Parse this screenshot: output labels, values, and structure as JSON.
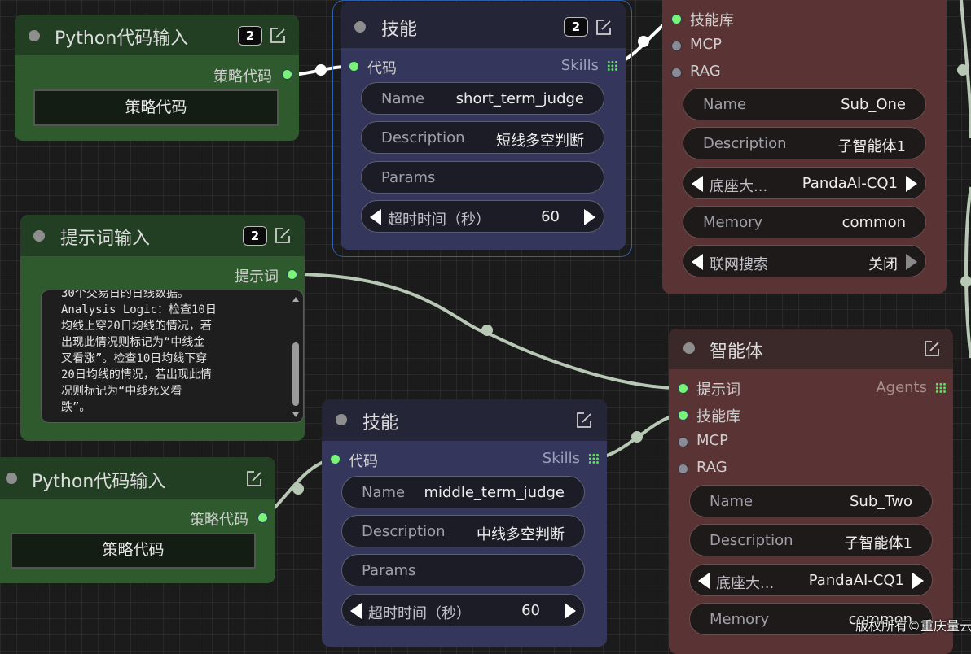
{
  "nodes": {
    "py_input_1": {
      "title": "Python代码输入",
      "badge": "2",
      "output_label": "策略代码",
      "button_label": "策略代码"
    },
    "prompt_input": {
      "title": "提示词输入",
      "badge": "2",
      "output_label": "提示词",
      "text": "30个交易日的日线数据。\nAnalysis Logic：检查10日\n均线上穿20日均线的情况，若\n出现此情况则标记为“中线金\n叉看涨”。检查10日均线下穿\n20日均线的情况，若出现此情\n况则标记为“中线死叉看\n跌”。"
    },
    "py_input_2": {
      "title": "Python代码输入",
      "output_label": "策略代码",
      "button_label": "策略代码"
    },
    "skill_1": {
      "title": "技能",
      "badge": "2",
      "input_label": "代码",
      "output_label": "Skills",
      "name_label": "Name",
      "name_value": "short_term_judge",
      "desc_label": "Description",
      "desc_value": "短线多空判断",
      "params_label": "Params",
      "timeout_label": "超时时间（秒）",
      "timeout_value": "60"
    },
    "skill_2": {
      "title": "技能",
      "input_label": "代码",
      "output_label": "Skills",
      "name_label": "Name",
      "name_value": "middle_term_judge",
      "desc_label": "Description",
      "desc_value": "中线多空判断",
      "params_label": "Params",
      "timeout_label": "超时时间（秒）",
      "timeout_value": "60"
    },
    "agent_top": {
      "inputs": [
        "技能库",
        "MCP",
        "RAG"
      ],
      "name_label": "Name",
      "name_value": "Sub_One",
      "desc_label": "Description",
      "desc_value": "子智能体1",
      "model_label": "底座大...",
      "model_value": "PandaAI-CQ1",
      "memory_label": "Memory",
      "memory_value": "common",
      "search_label": "联网搜索",
      "search_value": "关闭"
    },
    "agent_bottom": {
      "title": "智能体",
      "output_label": "Agents",
      "inputs": [
        "提示词",
        "技能库",
        "MCP",
        "RAG"
      ],
      "name_label": "Name",
      "name_value": "Sub_Two",
      "desc_label": "Description",
      "desc_value": "子智能体1",
      "model_label": "底座大...",
      "model_value": "PandaAI-CQ1",
      "memory_label": "Memory",
      "memory_value": "common"
    }
  },
  "watermark": "版权所有©重庆量云",
  "colors": {
    "canvas": "#1b1b1b",
    "green_node": "#2e5a2e",
    "green_header": "#233f23",
    "skill_node": "#34365c",
    "skill_header": "#242536",
    "agent_node": "#5a3434",
    "agent_header": "#3b2828",
    "port_active": "#7bf37b",
    "wire": "#b7c9b4"
  }
}
